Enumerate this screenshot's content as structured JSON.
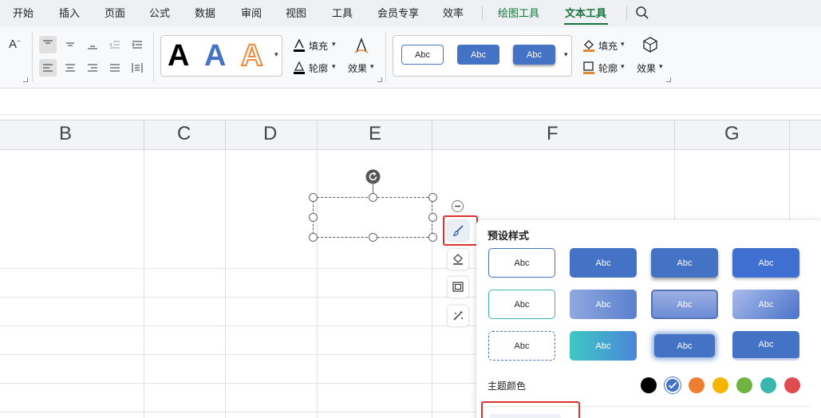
{
  "menu": {
    "items": [
      "开始",
      "插入",
      "页面",
      "公式",
      "数据",
      "审阅",
      "视图",
      "工具",
      "会员专享",
      "效率"
    ],
    "drawing_tools": "绘图工具",
    "text_tools": "文本工具",
    "search_icon": "search-icon"
  },
  "ribbon": {
    "font_size_decrease": "A",
    "wordart_letters": [
      "A",
      "A",
      "A"
    ],
    "text_fill": "填充",
    "text_outline": "轮廓",
    "text_effect": "效果",
    "shape_styles": [
      "Abc",
      "Abc",
      "Abc"
    ],
    "shape_fill": "填充",
    "shape_outline": "轮廓",
    "shape_effect": "效果"
  },
  "sheet": {
    "columns": [
      "B",
      "C",
      "D",
      "E",
      "F",
      "G"
    ]
  },
  "panel": {
    "title": "预设样式",
    "preset_text": "Abc",
    "theme_colors_label": "主题颜色",
    "theme_colors": [
      "#000000",
      "#4472c4",
      "#ed7d31",
      "#f4b400",
      "#70b440",
      "#3bb5b0",
      "#e04b50"
    ],
    "selected_theme_color": "#4472c4"
  },
  "colors": {
    "accent_green": "#16733c",
    "style_blue": "#4472c4",
    "highlight_red": "#e03030"
  }
}
